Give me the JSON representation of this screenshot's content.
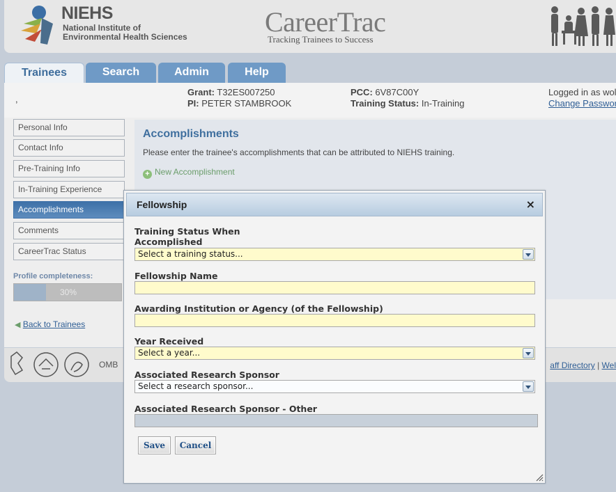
{
  "header": {
    "org_short": "NIEHS",
    "org_line1": "National Institute of",
    "org_line2": "Environmental Health Sciences",
    "app_title": "CareerTrac",
    "app_tagline": "Tracking Trainees to Success"
  },
  "tabs": [
    {
      "label": "Trainees",
      "active": true
    },
    {
      "label": "Search",
      "active": false
    },
    {
      "label": "Admin",
      "active": false
    },
    {
      "label": "Help",
      "active": false
    }
  ],
  "info": {
    "comma": ",",
    "grant_label": "Grant:",
    "grant_value": "T32ES007250",
    "pi_label": "PI:",
    "pi_value": "PETER STAMBROOK",
    "pcc_label": "PCC:",
    "pcc_value": "6V87C00Y",
    "status_label": "Training Status:",
    "status_value": "In-Training",
    "logged_in": "Logged in as wol",
    "change_password": "Change Passwor"
  },
  "sidebar": {
    "items": [
      {
        "label": "Personal Info"
      },
      {
        "label": "Contact Info"
      },
      {
        "label": "Pre-Training Info"
      },
      {
        "label": "In-Training Experience"
      },
      {
        "label": "Accomplishments",
        "active": true
      },
      {
        "label": "Comments"
      },
      {
        "label": "CareerTrac Status"
      }
    ],
    "profile_label": "Profile completeness:",
    "profile_value": "30%",
    "profile_fraction": 0.3,
    "back_link": "Back to Trainees"
  },
  "main": {
    "title": "Accomplishments",
    "description": "Please enter the trainee's accomplishments that can be attributed to NIEHS training.",
    "new_link": "New Accomplishment"
  },
  "footer": {
    "omb": "OMB",
    "links_left": "aff Directory",
    "separator": "|",
    "links_right": "Wel"
  },
  "dialog": {
    "title": "Fellowship",
    "close": "×",
    "fields": {
      "status_label_1": "Training Status When",
      "status_label_2": "Accomplished",
      "status_value": "Select a training status...",
      "name_label": "Fellowship Name",
      "name_value": "",
      "inst_label": "Awarding Institution or Agency (of the Fellowship)",
      "inst_value": "",
      "year_label": "Year Received",
      "year_value": "Select a year...",
      "sponsor_label": "Associated Research Sponsor",
      "sponsor_value": "Select a research sponsor...",
      "sponsor_other_label": "Associated Research Sponsor - Other",
      "sponsor_other_value": ""
    },
    "save": "Save",
    "cancel": "Cancel"
  },
  "colors": {
    "tab_blue": "#6f9ac6",
    "accent_blue": "#3f6f9e",
    "required_field": "#fffbcc",
    "dialog_header": "#b7cce0"
  }
}
